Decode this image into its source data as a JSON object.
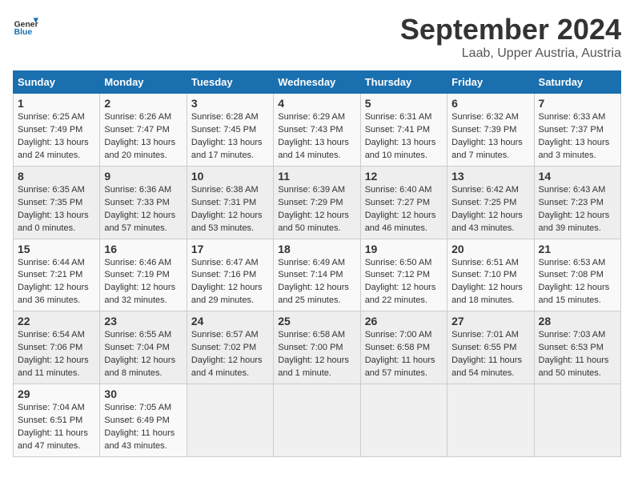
{
  "logo": {
    "text_general": "General",
    "text_blue": "Blue"
  },
  "title": "September 2024",
  "location": "Laab, Upper Austria, Austria",
  "days_of_week": [
    "Sunday",
    "Monday",
    "Tuesday",
    "Wednesday",
    "Thursday",
    "Friday",
    "Saturday"
  ],
  "weeks": [
    [
      {
        "day": "1",
        "info": "Sunrise: 6:25 AM\nSunset: 7:49 PM\nDaylight: 13 hours\nand 24 minutes."
      },
      {
        "day": "2",
        "info": "Sunrise: 6:26 AM\nSunset: 7:47 PM\nDaylight: 13 hours\nand 20 minutes."
      },
      {
        "day": "3",
        "info": "Sunrise: 6:28 AM\nSunset: 7:45 PM\nDaylight: 13 hours\nand 17 minutes."
      },
      {
        "day": "4",
        "info": "Sunrise: 6:29 AM\nSunset: 7:43 PM\nDaylight: 13 hours\nand 14 minutes."
      },
      {
        "day": "5",
        "info": "Sunrise: 6:31 AM\nSunset: 7:41 PM\nDaylight: 13 hours\nand 10 minutes."
      },
      {
        "day": "6",
        "info": "Sunrise: 6:32 AM\nSunset: 7:39 PM\nDaylight: 13 hours\nand 7 minutes."
      },
      {
        "day": "7",
        "info": "Sunrise: 6:33 AM\nSunset: 7:37 PM\nDaylight: 13 hours\nand 3 minutes."
      }
    ],
    [
      {
        "day": "8",
        "info": "Sunrise: 6:35 AM\nSunset: 7:35 PM\nDaylight: 13 hours\nand 0 minutes."
      },
      {
        "day": "9",
        "info": "Sunrise: 6:36 AM\nSunset: 7:33 PM\nDaylight: 12 hours\nand 57 minutes."
      },
      {
        "day": "10",
        "info": "Sunrise: 6:38 AM\nSunset: 7:31 PM\nDaylight: 12 hours\nand 53 minutes."
      },
      {
        "day": "11",
        "info": "Sunrise: 6:39 AM\nSunset: 7:29 PM\nDaylight: 12 hours\nand 50 minutes."
      },
      {
        "day": "12",
        "info": "Sunrise: 6:40 AM\nSunset: 7:27 PM\nDaylight: 12 hours\nand 46 minutes."
      },
      {
        "day": "13",
        "info": "Sunrise: 6:42 AM\nSunset: 7:25 PM\nDaylight: 12 hours\nand 43 minutes."
      },
      {
        "day": "14",
        "info": "Sunrise: 6:43 AM\nSunset: 7:23 PM\nDaylight: 12 hours\nand 39 minutes."
      }
    ],
    [
      {
        "day": "15",
        "info": "Sunrise: 6:44 AM\nSunset: 7:21 PM\nDaylight: 12 hours\nand 36 minutes."
      },
      {
        "day": "16",
        "info": "Sunrise: 6:46 AM\nSunset: 7:19 PM\nDaylight: 12 hours\nand 32 minutes."
      },
      {
        "day": "17",
        "info": "Sunrise: 6:47 AM\nSunset: 7:16 PM\nDaylight: 12 hours\nand 29 minutes."
      },
      {
        "day": "18",
        "info": "Sunrise: 6:49 AM\nSunset: 7:14 PM\nDaylight: 12 hours\nand 25 minutes."
      },
      {
        "day": "19",
        "info": "Sunrise: 6:50 AM\nSunset: 7:12 PM\nDaylight: 12 hours\nand 22 minutes."
      },
      {
        "day": "20",
        "info": "Sunrise: 6:51 AM\nSunset: 7:10 PM\nDaylight: 12 hours\nand 18 minutes."
      },
      {
        "day": "21",
        "info": "Sunrise: 6:53 AM\nSunset: 7:08 PM\nDaylight: 12 hours\nand 15 minutes."
      }
    ],
    [
      {
        "day": "22",
        "info": "Sunrise: 6:54 AM\nSunset: 7:06 PM\nDaylight: 12 hours\nand 11 minutes."
      },
      {
        "day": "23",
        "info": "Sunrise: 6:55 AM\nSunset: 7:04 PM\nDaylight: 12 hours\nand 8 minutes."
      },
      {
        "day": "24",
        "info": "Sunrise: 6:57 AM\nSunset: 7:02 PM\nDaylight: 12 hours\nand 4 minutes."
      },
      {
        "day": "25",
        "info": "Sunrise: 6:58 AM\nSunset: 7:00 PM\nDaylight: 12 hours\nand 1 minute."
      },
      {
        "day": "26",
        "info": "Sunrise: 7:00 AM\nSunset: 6:58 PM\nDaylight: 11 hours\nand 57 minutes."
      },
      {
        "day": "27",
        "info": "Sunrise: 7:01 AM\nSunset: 6:55 PM\nDaylight: 11 hours\nand 54 minutes."
      },
      {
        "day": "28",
        "info": "Sunrise: 7:03 AM\nSunset: 6:53 PM\nDaylight: 11 hours\nand 50 minutes."
      }
    ],
    [
      {
        "day": "29",
        "info": "Sunrise: 7:04 AM\nSunset: 6:51 PM\nDaylight: 11 hours\nand 47 minutes."
      },
      {
        "day": "30",
        "info": "Sunrise: 7:05 AM\nSunset: 6:49 PM\nDaylight: 11 hours\nand 43 minutes."
      },
      {
        "day": "",
        "info": ""
      },
      {
        "day": "",
        "info": ""
      },
      {
        "day": "",
        "info": ""
      },
      {
        "day": "",
        "info": ""
      },
      {
        "day": "",
        "info": ""
      }
    ]
  ]
}
